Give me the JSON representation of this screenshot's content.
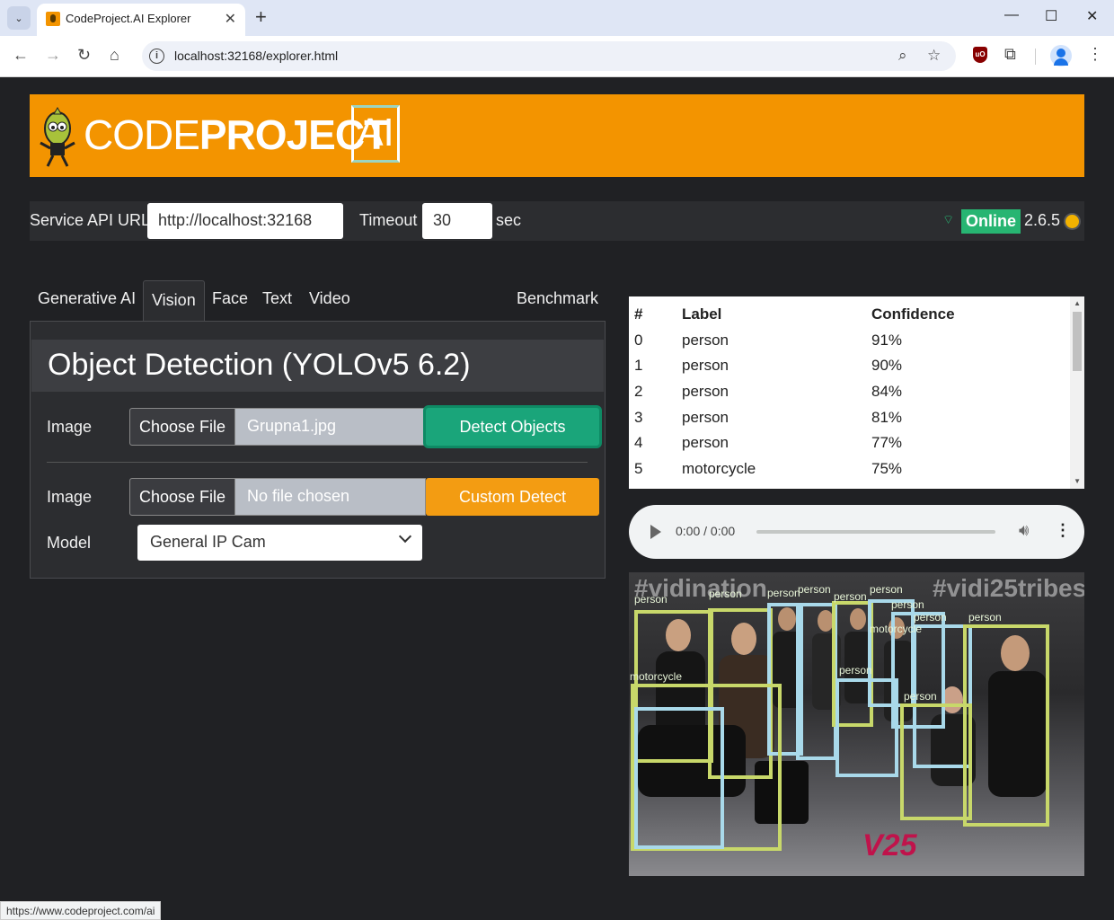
{
  "browser": {
    "tab_title": "CodeProject.AI Explorer",
    "url": "localhost:32168/explorer.html",
    "status_url": "https://www.codeproject.com/ai"
  },
  "banner": {
    "logo_light": "CODE",
    "logo_bold": "PROJECT",
    "logo_ai": "AI"
  },
  "settings": {
    "api_label": "Service API URL",
    "api_value": "http://localhost:32168",
    "timeout_label": "Timeout",
    "timeout_value": "30",
    "timeout_unit": "sec",
    "status": "Online",
    "version": "2.6.5"
  },
  "tabs": {
    "generative": "Generative AI",
    "vision": "Vision",
    "face": "Face",
    "text": "Text",
    "video": "Video",
    "benchmark": "Benchmark"
  },
  "panel": {
    "title": "Object Detection (YOLOv5 6.2)",
    "row1": {
      "label": "Image",
      "file_button": "Choose File",
      "file_name": "Grupna1.jpg",
      "action": "Detect Objects"
    },
    "row2": {
      "label": "Image",
      "file_button": "Choose File",
      "file_name": "No file chosen",
      "action": "Custom Detect"
    },
    "model_label": "Model",
    "model_value": "General IP Cam"
  },
  "results": {
    "headers": [
      "#",
      "Label",
      "Confidence"
    ],
    "rows": [
      {
        "idx": "0",
        "label": "person",
        "conf": "91%"
      },
      {
        "idx": "1",
        "label": "person",
        "conf": "90%"
      },
      {
        "idx": "2",
        "label": "person",
        "conf": "84%"
      },
      {
        "idx": "3",
        "label": "person",
        "conf": "81%"
      },
      {
        "idx": "4",
        "label": "person",
        "conf": "77%"
      },
      {
        "idx": "5",
        "label": "motorcycle",
        "conf": "75%"
      }
    ]
  },
  "audio": {
    "time": "0:00 / 0:00"
  },
  "photo": {
    "watermark_left": "#vidination",
    "watermark_right": "#vidi25tribes",
    "brand": "V25",
    "box_labels": [
      "person",
      "person",
      "person",
      "person",
      "person",
      "person",
      "person",
      "person",
      "person",
      "motorcycle",
      "motorcycle",
      "person",
      "person"
    ]
  },
  "colors": {
    "banner": "#f39400",
    "online": "#27b572",
    "detect": "#1aa57a",
    "custom": "#f39c12",
    "box_green": "#c8d86a",
    "box_blue": "#a9d9ea"
  }
}
